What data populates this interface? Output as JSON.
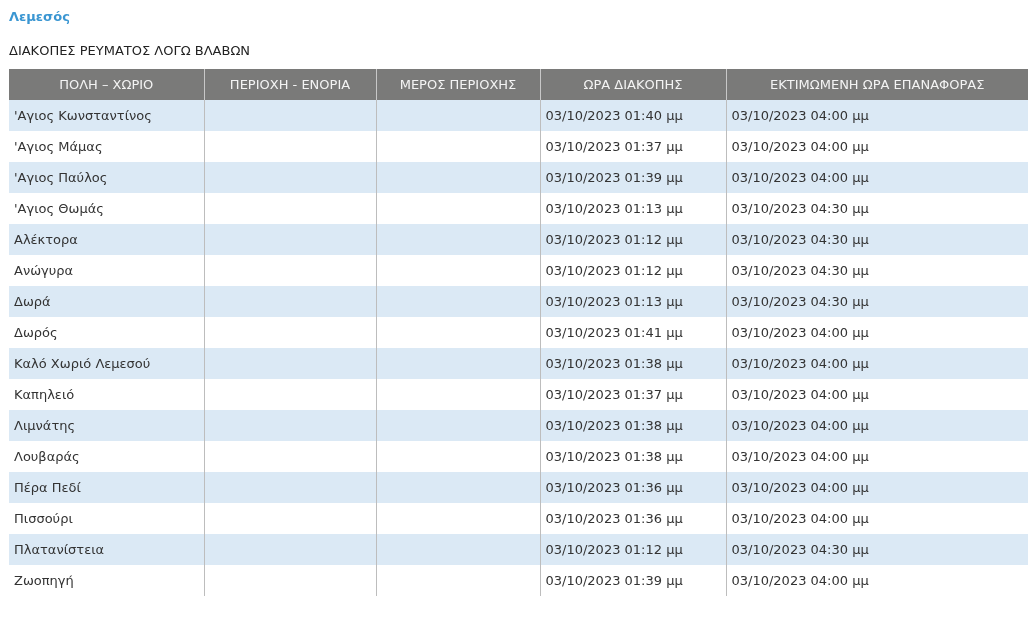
{
  "region_link": "Λεμεσός",
  "heading": "ΔΙΑΚΟΠΕΣ ΡΕΥΜΑΤΟΣ ΛΟΓΩ ΒΛΑΒΩΝ",
  "table": {
    "columns": [
      "ΠΟΛΗ – ΧΩΡΙΟ",
      "ΠΕΡΙΟΧΗ - ΕΝΟΡΙΑ",
      "ΜΕΡΟΣ ΠΕΡΙΟΧΗΣ",
      "ΩΡΑ ΔΙΑΚΟΠΗΣ",
      "ΕΚΤΙΜΩΜΕΝΗ ΩΡΑ ΕΠΑΝΑΦΟΡΑΣ"
    ],
    "rows": [
      {
        "place": "'Αγιος Κωνσταντίνος",
        "outage_time": "03/10/2023 01:40 μμ",
        "restore_time": "03/10/2023 04:00 μμ"
      },
      {
        "place": "'Αγιος Μάμας",
        "outage_time": "03/10/2023 01:37 μμ",
        "restore_time": "03/10/2023 04:00 μμ"
      },
      {
        "place": "'Αγιος Παύλος",
        "outage_time": "03/10/2023 01:39 μμ",
        "restore_time": "03/10/2023 04:00 μμ"
      },
      {
        "place": "'Αγιος Θωμάς",
        "outage_time": "03/10/2023 01:13 μμ",
        "restore_time": "03/10/2023 04:30 μμ"
      },
      {
        "place": "Αλέκτορα",
        "outage_time": "03/10/2023 01:12 μμ",
        "restore_time": "03/10/2023 04:30 μμ"
      },
      {
        "place": "Ανώγυρα",
        "outage_time": "03/10/2023 01:12 μμ",
        "restore_time": "03/10/2023 04:30 μμ"
      },
      {
        "place": "Δωρά",
        "outage_time": "03/10/2023 01:13 μμ",
        "restore_time": "03/10/2023 04:30 μμ"
      },
      {
        "place": "Δωρός",
        "outage_time": "03/10/2023 01:41 μμ",
        "restore_time": "03/10/2023 04:00 μμ"
      },
      {
        "place": "Καλό Χωριό Λεμεσού",
        "outage_time": "03/10/2023 01:38 μμ",
        "restore_time": "03/10/2023 04:00 μμ"
      },
      {
        "place": "Καπηλειό",
        "outage_time": "03/10/2023 01:37 μμ",
        "restore_time": "03/10/2023 04:00 μμ"
      },
      {
        "place": "Λιμνάτης",
        "outage_time": "03/10/2023 01:38 μμ",
        "restore_time": "03/10/2023 04:00 μμ"
      },
      {
        "place": "Λουβαράς",
        "outage_time": "03/10/2023 01:38 μμ",
        "restore_time": "03/10/2023 04:00 μμ"
      },
      {
        "place": "Πέρα Πεδί",
        "outage_time": "03/10/2023 01:36 μμ",
        "restore_time": "03/10/2023 04:00 μμ"
      },
      {
        "place": "Πισσούρι",
        "outage_time": "03/10/2023 01:36 μμ",
        "restore_time": "03/10/2023 04:00 μμ"
      },
      {
        "place": "Πλατανίστεια",
        "outage_time": "03/10/2023 01:12 μμ",
        "restore_time": "03/10/2023 04:30 μμ"
      },
      {
        "place": "Ζωοπηγή",
        "outage_time": "03/10/2023 01:39 μμ",
        "restore_time": "03/10/2023 04:00 μμ"
      }
    ]
  }
}
